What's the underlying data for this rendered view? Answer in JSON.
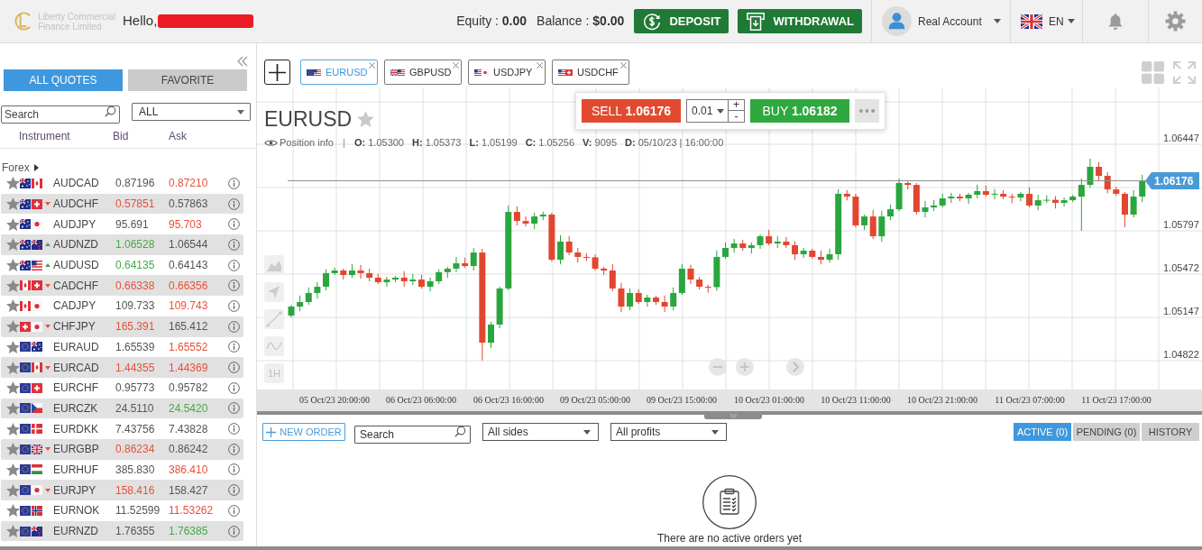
{
  "header": {
    "logo_text": "Liberty Commercial Finance Limited",
    "greeting": "Hello,",
    "equity": "Equity : **0.00**",
    "balance": "Balance : **$0.00**",
    "deposit_button": "DEPOSIT",
    "withdrawal_button": "WITHDRAWAL",
    "account": "Real Account",
    "language": "EN"
  },
  "quotes_panel": {
    "tabs": [
      {
        "label": "ALL QUOTES",
        "selected": true
      },
      {
        "label": "FAVORITE",
        "selected": false
      }
    ],
    "search": {
      "placeholder": "Search"
    },
    "filter": "ALL",
    "columns": [
      "Instrument",
      "Bid",
      "Ask"
    ],
    "group": "Forex",
    "rows": [
      {
        "flags": [
          {
            "kind": "au"
          },
          {
            "kind": "ca"
          }
        ],
        "symbol": "AUDCAD",
        "bid": "0.87196",
        "bid_rising": false,
        "bid_falling": false,
        "ask": "0.87210",
        "ask_rising": false,
        "ask_falling": true
      },
      {
        "flags": [
          {
            "kind": "au"
          },
          {
            "kind": "ch"
          }
        ],
        "symbol": "AUDCHF",
        "bid": "0.57851",
        "bid_rising": false,
        "bid_falling": true,
        "ask": "0.57863",
        "ask_rising": false,
        "ask_falling": false
      },
      {
        "flags": [
          {
            "kind": "au"
          },
          {
            "kind": "jp"
          }
        ],
        "symbol": "AUDJPY",
        "bid": "95.691",
        "bid_rising": false,
        "bid_falling": false,
        "ask": "95.703",
        "ask_rising": false,
        "ask_falling": true
      },
      {
        "flags": [
          {
            "kind": "au"
          },
          {
            "kind": "nz"
          }
        ],
        "symbol": "AUDNZD",
        "bid": "1.06528",
        "bid_rising": true,
        "bid_falling": false,
        "ask": "1.06544",
        "ask_rising": false,
        "ask_falling": false
      },
      {
        "flags": [
          {
            "kind": "au"
          },
          {
            "kind": "us"
          }
        ],
        "symbol": "AUDUSD",
        "bid": "0.64135",
        "bid_rising": true,
        "bid_falling": false,
        "ask": "0.64143",
        "ask_rising": false,
        "ask_falling": false
      },
      {
        "flags": [
          {
            "kind": "ca"
          },
          {
            "kind": "ch"
          }
        ],
        "symbol": "CADCHF",
        "bid": "0.66338",
        "bid_rising": false,
        "bid_falling": true,
        "ask": "0.66356",
        "ask_rising": false,
        "ask_falling": true
      },
      {
        "flags": [
          {
            "kind": "ca"
          },
          {
            "kind": "jp"
          }
        ],
        "symbol": "CADJPY",
        "bid": "109.733",
        "bid_rising": false,
        "bid_falling": false,
        "ask": "109.743",
        "ask_rising": false,
        "ask_falling": true
      },
      {
        "flags": [
          {
            "kind": "ch"
          },
          {
            "kind": "jp"
          }
        ],
        "symbol": "CHFJPY",
        "bid": "165.391",
        "bid_rising": false,
        "bid_falling": true,
        "ask": "165.412",
        "ask_rising": false,
        "ask_falling": false
      },
      {
        "flags": [
          {
            "kind": "eu"
          },
          {
            "kind": "au"
          }
        ],
        "symbol": "EURAUD",
        "bid": "1.65539",
        "bid_rising": false,
        "bid_falling": false,
        "ask": "1.65552",
        "ask_rising": false,
        "ask_falling": true
      },
      {
        "flags": [
          {
            "kind": "eu"
          },
          {
            "kind": "ca"
          }
        ],
        "symbol": "EURCAD",
        "bid": "1.44355",
        "bid_rising": false,
        "bid_falling": true,
        "ask": "1.44369",
        "ask_rising": false,
        "ask_falling": true
      },
      {
        "flags": [
          {
            "kind": "eu"
          },
          {
            "kind": "ch"
          }
        ],
        "symbol": "EURCHF",
        "bid": "0.95773",
        "bid_rising": false,
        "bid_falling": false,
        "ask": "0.95782",
        "ask_rising": false,
        "ask_falling": false
      },
      {
        "flags": [
          {
            "kind": "eu"
          },
          {
            "kind": "cz"
          }
        ],
        "symbol": "EURCZK",
        "bid": "24.5110",
        "bid_rising": false,
        "bid_falling": false,
        "ask": "24.5420",
        "ask_rising": true,
        "ask_falling": false
      },
      {
        "flags": [
          {
            "kind": "eu"
          },
          {
            "kind": "dk"
          }
        ],
        "symbol": "EURDKK",
        "bid": "7.43756",
        "bid_rising": false,
        "bid_falling": false,
        "ask": "7.43828",
        "ask_rising": false,
        "ask_falling": false
      },
      {
        "flags": [
          {
            "kind": "eu"
          },
          {
            "kind": "gb"
          }
        ],
        "symbol": "EURGBP",
        "bid": "0.86234",
        "bid_rising": false,
        "bid_falling": true,
        "ask": "0.86242",
        "ask_rising": false,
        "ask_falling": false
      },
      {
        "flags": [
          {
            "kind": "eu"
          },
          {
            "kind": "hu"
          }
        ],
        "symbol": "EURHUF",
        "bid": "385.830",
        "bid_rising": false,
        "bid_falling": false,
        "ask": "386.410",
        "ask_rising": false,
        "ask_falling": true
      },
      {
        "flags": [
          {
            "kind": "eu"
          },
          {
            "kind": "jp"
          }
        ],
        "symbol": "EURJPY",
        "bid": "158.416",
        "bid_rising": false,
        "bid_falling": true,
        "ask": "158.427",
        "ask_rising": false,
        "ask_falling": false
      },
      {
        "flags": [
          {
            "kind": "eu"
          },
          {
            "kind": "no"
          }
        ],
        "symbol": "EURNOK",
        "bid": "11.52599",
        "bid_rising": false,
        "bid_falling": false,
        "ask": "11.53262",
        "ask_rising": false,
        "ask_falling": true
      },
      {
        "flags": [
          {
            "kind": "eu"
          },
          {
            "kind": "nz"
          }
        ],
        "symbol": "EURNZD",
        "bid": "1.76355",
        "bid_rising": false,
        "bid_falling": false,
        "ask": "1.76385",
        "ask_rising": true,
        "ask_falling": false
      }
    ]
  },
  "chart_tabs": [
    {
      "label": "EURUSD",
      "flags": [
        {
          "kind": "eu"
        },
        {
          "kind": "us"
        }
      ],
      "selected": true
    },
    {
      "label": "GBPUSD",
      "flags": [
        {
          "kind": "gb"
        },
        {
          "kind": "us"
        }
      ],
      "selected": false
    },
    {
      "label": "USDJPY",
      "flags": [
        {
          "kind": "us"
        },
        {
          "kind": "jp"
        }
      ],
      "selected": false
    },
    {
      "label": "USDCHF",
      "flags": [
        {
          "kind": "us"
        },
        {
          "kind": "ch"
        }
      ],
      "selected": false
    }
  ],
  "chart": {
    "title": "EURUSD",
    "position_info": "Position info",
    "ohlc": [
      "**O:** 1.05300",
      "**H:** 1.05373",
      "**L:** 1.05199",
      "**C:** 1.05256",
      "**V:** 9095",
      "**D:** 05/10/23 | 16:00:00"
    ],
    "trade": {
      "sell": "SELL **1.06176**",
      "quantity": "0.01",
      "increment": "+",
      "decrement": "-",
      "buy": "BUY **1.06182**"
    },
    "timeframe": "1H",
    "chart_data": {
      "type": "candlestick",
      "categories": [
        null,
        null,
        null,
        null,
        null,
        "05 Oct/23 20:00:00",
        null,
        null,
        null,
        null,
        null,
        null,
        null,
        null,
        null,
        "06 Oct/23 06:00:00",
        null,
        null,
        null,
        null,
        null,
        null,
        null,
        null,
        null,
        "06 Oct/23 16:00:00",
        null,
        null,
        null,
        null,
        null,
        null,
        null,
        null,
        null,
        "09 Oct/23 05:00:00",
        null,
        null,
        null,
        null,
        null,
        null,
        null,
        null,
        null,
        "09 Oct/23 15:00:00",
        null,
        null,
        null,
        null,
        null,
        null,
        null,
        null,
        null,
        "10 Oct/23 01:00:00",
        null,
        null,
        null,
        null,
        null,
        null,
        null,
        null,
        null,
        "10 Oct/23 11:00:00",
        null,
        null,
        null,
        null,
        null,
        null,
        null,
        null,
        null,
        "10 Oct/23 21:00:00",
        null,
        null,
        null,
        null,
        null,
        null,
        null,
        null,
        null,
        "11 Oct/23 07:00:00",
        null,
        null,
        null,
        null,
        null,
        null,
        null,
        null,
        null,
        "11 Oct/23 17:00:00",
        null,
        null,
        null
      ],
      "ohlc": [
        [
          1.0516,
          1.05242,
          1.05146,
          1.05228
        ],
        [
          1.05228,
          1.05311,
          1.05193,
          1.05262
        ],
        [
          1.05262,
          1.05372,
          1.05241,
          1.0533
        ],
        [
          1.0533,
          1.05412,
          1.05288,
          1.05377
        ],
        [
          1.05377,
          1.05507,
          1.05349,
          1.05479
        ],
        [
          1.05479,
          1.0552,
          1.05465,
          1.05499
        ],
        [
          1.05499,
          1.05513,
          1.0543,
          1.05465
        ],
        [
          1.05465,
          1.05548,
          1.05444,
          1.05499
        ],
        [
          1.05499,
          1.05541,
          1.05437,
          1.05479
        ],
        [
          1.05479,
          1.05514,
          1.05417,
          1.05445
        ],
        [
          1.05445,
          1.05473,
          1.05397,
          1.05411
        ],
        [
          1.05411,
          1.05452,
          1.05376,
          1.05431
        ],
        [
          1.05431,
          1.05459,
          1.0541,
          1.05445
        ],
        [
          1.05445,
          1.05494,
          1.05376,
          1.05418
        ],
        [
          1.05418,
          1.05473,
          1.0539,
          1.05431
        ],
        [
          1.05431,
          1.05466,
          1.05363,
          1.05377
        ],
        [
          1.05377,
          1.05446,
          1.05342,
          1.05418
        ],
        [
          1.05418,
          1.05507,
          1.05397,
          1.05486
        ],
        [
          1.05486,
          1.05527,
          1.05444,
          1.05513
        ],
        [
          1.05513,
          1.05602,
          1.05485,
          1.05553
        ],
        [
          1.05553,
          1.05595,
          1.05519,
          1.05533
        ],
        [
          1.05533,
          1.05668,
          1.05498,
          1.05634
        ],
        [
          1.05634,
          1.05662,
          1.04822,
          1.04957
        ],
        [
          1.04957,
          1.05114,
          1.04915,
          1.05093
        ],
        [
          1.05093,
          1.05378,
          1.05065,
          1.05364
        ],
        [
          1.05364,
          1.05987,
          1.0535,
          1.05939
        ],
        [
          1.05939,
          1.05981,
          1.05836,
          1.05871
        ],
        [
          1.05871,
          1.05906,
          1.0583,
          1.05851
        ],
        [
          1.05851,
          1.05933,
          1.05809,
          1.05905
        ],
        [
          1.05905,
          1.0594,
          1.05877,
          1.05919
        ],
        [
          1.05919,
          1.05933,
          1.05566,
          1.0558
        ],
        [
          1.0558,
          1.05765,
          1.05545,
          1.05716
        ],
        [
          1.05716,
          1.05758,
          1.05613,
          1.05634
        ],
        [
          1.05634,
          1.05669,
          1.05559,
          1.05601
        ],
        [
          1.05601,
          1.05629,
          1.0557,
          1.05598
        ],
        [
          1.05598,
          1.05619,
          1.05499,
          1.05513
        ],
        [
          1.05513,
          1.05527,
          1.05464,
          1.05499
        ],
        [
          1.05499,
          1.05548,
          1.05343,
          1.05364
        ],
        [
          1.05364,
          1.05406,
          1.05186,
          1.05228
        ],
        [
          1.05228,
          1.05365,
          1.052,
          1.0533
        ],
        [
          1.0533,
          1.05358,
          1.05248,
          1.05262
        ],
        [
          1.05262,
          1.05317,
          1.05227,
          1.05296
        ],
        [
          1.05296,
          1.0531,
          1.05241,
          1.05262
        ],
        [
          1.05262,
          1.05311,
          1.05186,
          1.05228
        ],
        [
          1.05228,
          1.05372,
          1.052,
          1.0533
        ],
        [
          1.0533,
          1.05548,
          1.05316,
          1.05513
        ],
        [
          1.05513,
          1.05541,
          1.05396,
          1.05431
        ],
        [
          1.05431,
          1.05452,
          1.05356,
          1.05377
        ],
        [
          1.05377,
          1.05391,
          1.05332,
          1.05374
        ],
        [
          1.05374,
          1.0565,
          1.05346,
          1.05601
        ],
        [
          1.05601,
          1.0571,
          1.05587,
          1.05668
        ],
        [
          1.05668,
          1.05737,
          1.05633,
          1.05702
        ],
        [
          1.05702,
          1.0573,
          1.05647,
          1.05668
        ],
        [
          1.05668,
          1.0571,
          1.05626,
          1.05689
        ],
        [
          1.05689,
          1.0577,
          1.05661,
          1.05756
        ],
        [
          1.05756,
          1.05805,
          1.05688,
          1.05702
        ],
        [
          1.05702,
          1.05758,
          1.05667,
          1.05716
        ],
        [
          1.05716,
          1.05751,
          1.05668,
          1.05689
        ],
        [
          1.05689,
          1.05717,
          1.05579,
          1.05621
        ],
        [
          1.05621,
          1.05669,
          1.05593,
          1.05648
        ],
        [
          1.05648,
          1.05662,
          1.05587,
          1.05601
        ],
        [
          1.05601,
          1.0565,
          1.05545,
          1.0558
        ],
        [
          1.0558,
          1.05663,
          1.05559,
          1.05621
        ],
        [
          1.05621,
          1.0611,
          1.05579,
          1.06075
        ],
        [
          1.06075,
          1.06103,
          1.06026,
          1.06054
        ],
        [
          1.06054,
          1.06075,
          1.05824,
          1.05838
        ],
        [
          1.05838,
          1.05919,
          1.05803,
          1.05905
        ],
        [
          1.05905,
          1.05954,
          1.05735,
          1.05756
        ],
        [
          1.05756,
          1.05947,
          1.05714,
          1.05905
        ],
        [
          1.05905,
          1.05994,
          1.05877,
          1.05959
        ],
        [
          1.05959,
          1.0619,
          1.05945,
          1.06156
        ],
        [
          1.06156,
          1.06177,
          1.06107,
          1.06142
        ],
        [
          1.06142,
          1.06156,
          1.05918,
          1.05939
        ],
        [
          1.05939,
          1.06022,
          1.05897,
          1.05973
        ],
        [
          1.05973,
          1.06029,
          1.05945,
          1.05987
        ],
        [
          1.05987,
          1.06076,
          1.05973,
          1.06041
        ],
        [
          1.06041,
          1.06082,
          1.06006,
          1.06054
        ],
        [
          1.06054,
          1.06075,
          1.0602,
          1.06041
        ],
        [
          1.06041,
          1.06082,
          1.05999,
          1.06068
        ],
        [
          1.06068,
          1.06144,
          1.0604,
          1.06095
        ],
        [
          1.06095,
          1.06137,
          1.06054,
          1.06068
        ],
        [
          1.06068,
          1.0611,
          1.06033,
          1.06075
        ],
        [
          1.06075,
          1.06103,
          1.06033,
          1.06054
        ],
        [
          1.06054,
          1.06075,
          1.06005,
          1.06047
        ],
        [
          1.06047,
          1.06089,
          1.06019,
          1.06075
        ],
        [
          1.06075,
          1.06124,
          1.05973,
          1.05987
        ],
        [
          1.05987,
          1.06069,
          1.05952,
          1.06027
        ],
        [
          1.06027,
          1.06065,
          1.06006,
          1.0603
        ],
        [
          1.0603,
          1.06058,
          1.05965,
          1.06007
        ],
        [
          1.06007,
          1.06048,
          1.05979,
          1.06027
        ],
        [
          1.06027,
          1.06068,
          1.06013,
          1.06054
        ],
        [
          1.06054,
          1.06191,
          1.05797,
          1.06142
        ],
        [
          1.06142,
          1.06339,
          1.06121,
          1.06278
        ],
        [
          1.06278,
          1.06313,
          1.06168,
          1.0621
        ],
        [
          1.0621,
          1.06238,
          1.0608,
          1.06108
        ],
        [
          1.06108,
          1.06129,
          1.06061,
          1.06075
        ],
        [
          1.06075,
          1.06089,
          1.05824,
          1.05919
        ],
        [
          1.05919,
          1.06103,
          1.05898,
          1.06054
        ],
        [
          1.06054,
          1.06218,
          1.06012,
          1.06176
        ]
      ],
      "ylim": [
        1.04605,
        1.06874
      ],
      "yticks": [
        1.06447,
        1.05797,
        1.05472,
        1.05147,
        1.04822
      ],
      "grid": true,
      "ref_lines": [
        {
          "axis": "y",
          "value": 1.06176,
          "label": "1.06176"
        }
      ]
    }
  },
  "orders": {
    "new_order": "NEW ORDER",
    "search": {
      "placeholder": "Search"
    },
    "side_filter": "All sides",
    "profit_filter": "All profits",
    "tabs": [
      {
        "label": "ACTIVE (0)",
        "selected": true
      },
      {
        "label": "PENDING (0)",
        "selected": false
      },
      {
        "label": "HISTORY",
        "selected": false
      }
    ],
    "empty_message": "There are no active orders yet"
  }
}
